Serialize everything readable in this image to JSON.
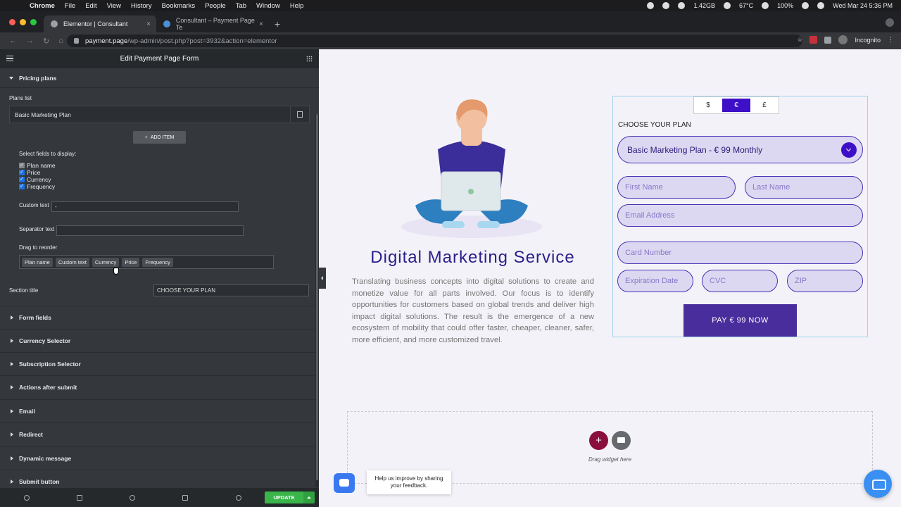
{
  "menubar": {
    "app": "Chrome",
    "items": [
      "File",
      "Edit",
      "View",
      "History",
      "Bookmarks",
      "People",
      "Tab",
      "Window",
      "Help"
    ],
    "memory": "1.42GB",
    "temp": "67°C",
    "battery": "100%",
    "datetime": "Wed Mar 24  5:36 PM"
  },
  "browser": {
    "tabs": [
      {
        "title": "Elementor | Consultant"
      },
      {
        "title": "Consultant – Payment Page Te"
      }
    ],
    "url_domain": "payment.page",
    "url_path": "/wp-admin/post.php?post=3932&action=elementor",
    "profile": "Incognito"
  },
  "panel": {
    "title": "Edit Payment Page Form",
    "section_open": "Pricing plans",
    "plans_list_label": "Plans list",
    "plan_item": "Basic Marketing Plan",
    "add_item": "ADD ITEM",
    "fields_label": "Select fields to display:",
    "fields": [
      "Plan name",
      "Price",
      "Currency",
      "Frequency"
    ],
    "custom_text_label": "Custom text",
    "custom_text_value": "-",
    "separator_label": "Separator text",
    "separator_value": "",
    "reorder_label": "Drag to reorder",
    "reorder_items": [
      "Plan name",
      "Custom text",
      "Currency",
      "Price",
      "Frequency"
    ],
    "section_title_label": "Section title",
    "section_title_value": "CHOOSE YOUR PLAN",
    "sections": [
      "Form fields",
      "Currency Selector",
      "Subscription Selector",
      "Actions after submit",
      "Email",
      "Redirect",
      "Dynamic message",
      "Submit button"
    ],
    "update": "UPDATE"
  },
  "page": {
    "heading": "Digital Marketing Service",
    "description": "Translating business concepts into digital solutions to create and monetize value for all parts involved. Our focus is to identify opportunities for customers based on global trends and deliver high impact digital solutions. The result is the emergence of a new ecosystem of mobility that could offer faster, cheaper, cleaner, safer, more efficient, and more customized travel.",
    "currencies": [
      "$",
      "€",
      "£"
    ],
    "selected_currency": "€",
    "choose_title": "CHOOSE YOUR PLAN",
    "plan_select": "Basic Marketing Plan - € 99 Monthly",
    "first_name": "First Name",
    "last_name": "Last Name",
    "email": "Email Address",
    "card": "Card Number",
    "exp": "Expiration Date",
    "cvc": "CVC",
    "zip": "ZIP",
    "pay_button": "PAY € 99 NOW",
    "drag_widget": "Drag widget here",
    "feedback": "Help us improve by sharing your feedback."
  },
  "colors": {
    "accent": "#3d0fc7",
    "button": "#4a2d9c",
    "update": "#39b54a",
    "heading": "#2a1e8c"
  }
}
